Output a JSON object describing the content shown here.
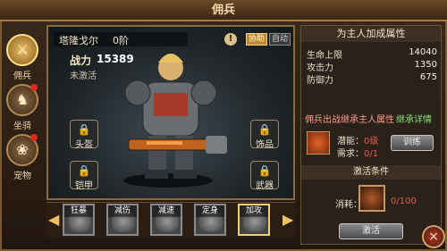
{
  "window": {
    "title": "佣兵",
    "close_icon": "×"
  },
  "nav": {
    "items": [
      {
        "label": "佣兵",
        "icon": "helmet-icon",
        "glyph": "⚔",
        "active": true,
        "dot": false
      },
      {
        "label": "坐骑",
        "icon": "mount-icon",
        "glyph": "♞",
        "active": false,
        "dot": true
      },
      {
        "label": "宠物",
        "icon": "pet-icon",
        "glyph": "❀",
        "active": false,
        "dot": true
      }
    ]
  },
  "hero": {
    "name": "塔隆戈尔",
    "rank": "0阶",
    "power_label": "战力",
    "power_value": "15389",
    "status": "未激活",
    "info_icon": "!",
    "assist_label": "协助",
    "auto_label": "自动",
    "slots": [
      {
        "label": "头盔"
      },
      {
        "label": "铠甲"
      },
      {
        "label": "饰品"
      },
      {
        "label": "武器"
      }
    ]
  },
  "skills": [
    {
      "label": "狂暴"
    },
    {
      "label": "减伤"
    },
    {
      "label": "减速"
    },
    {
      "label": "定身"
    },
    {
      "label": "加攻"
    }
  ],
  "attributes": {
    "heading": "为主人加成属性",
    "rows": [
      {
        "label": "生命上限",
        "value": "14040"
      },
      {
        "label": "攻击力",
        "value": "1350"
      },
      {
        "label": "防御力",
        "value": "675"
      }
    ]
  },
  "inherit": {
    "label": "佣兵出战继承主人属性",
    "link": "继承详情"
  },
  "potential": {
    "level_label": "潜能：",
    "level_value": "0级",
    "need_label": "需求：",
    "need_value": "0/1",
    "upgrade_label": "训练"
  },
  "activation": {
    "heading": "激活条件",
    "consume_label": "消耗：",
    "consume_count": "0/100",
    "activate_label": "激活"
  },
  "colors": {
    "accent": "#c08a2a",
    "warning": "#e85a4a",
    "link": "#8ae070"
  }
}
